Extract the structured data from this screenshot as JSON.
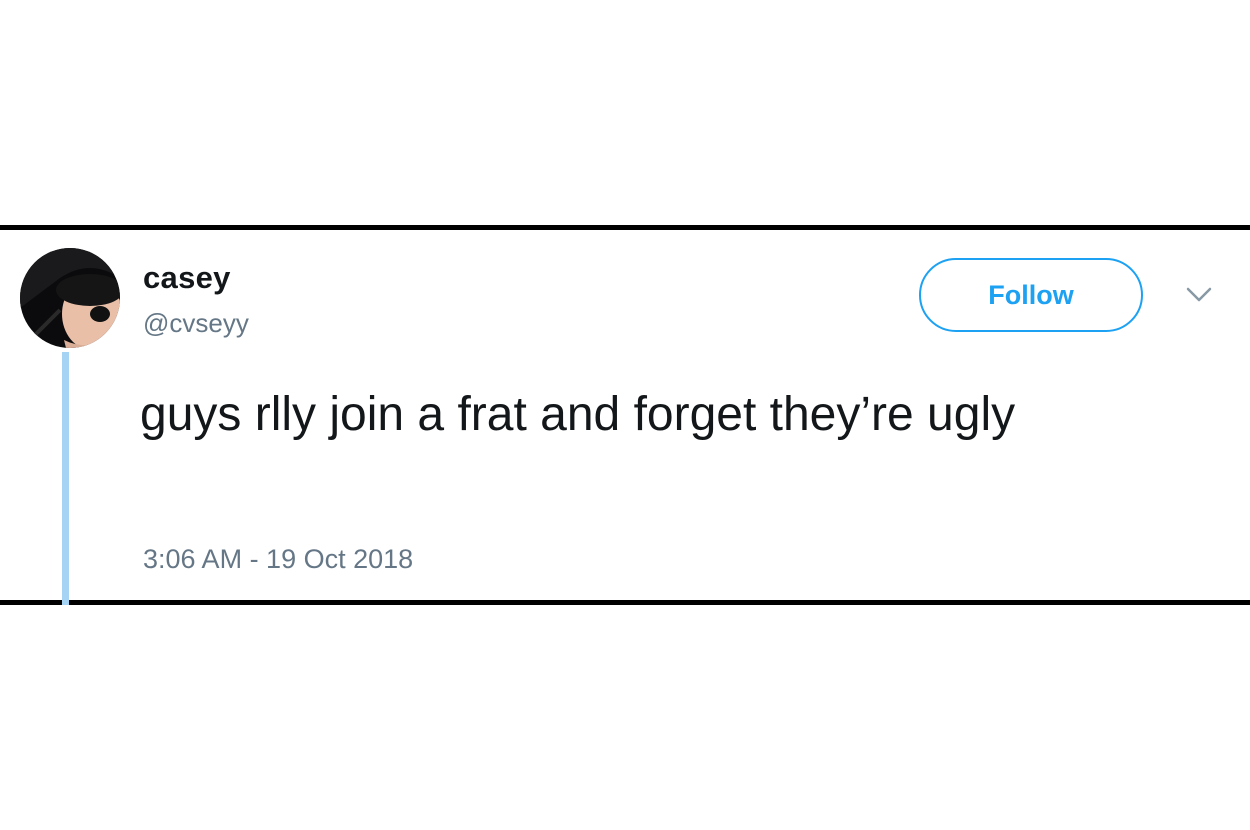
{
  "tweet": {
    "author": {
      "display_name": "casey",
      "handle": "@cvseyy",
      "avatar_icon": "profile-photo-avatar"
    },
    "follow_label": "Follow",
    "menu_icon": "chevron-down-icon",
    "text": "guys rlly join a frat and forget they’re ugly",
    "timestamp": "3:06 AM - 19 Oct 2018"
  },
  "colors": {
    "accent": "#1da1f2",
    "thread_line": "#a5d3f3",
    "secondary_text": "#657786",
    "primary_text": "#14171a",
    "border": "#000000"
  }
}
